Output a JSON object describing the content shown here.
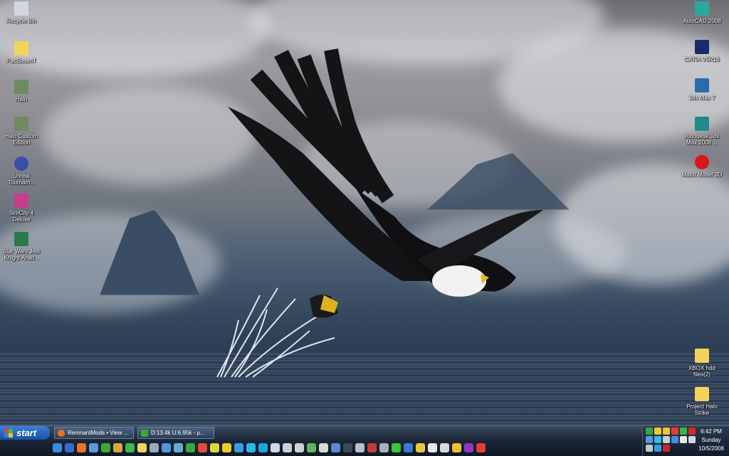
{
  "desktop": {
    "left_icons": [
      {
        "label": "Recycle Bin",
        "icon": "recycle-bin-icon",
        "color": "#cfd8e0"
      },
      {
        "label": "PacSteamT",
        "icon": "folder-icon",
        "color": "#f3d35a"
      },
      {
        "label": "Halo",
        "icon": "halo-icon",
        "color": "#6e8a5e"
      },
      {
        "label": "Halo Custom Edition",
        "icon": "halo-ce-icon",
        "color": "#6e8a5e"
      },
      {
        "label": "Unreal Tournam...",
        "icon": "unreal-icon",
        "color": "#3a4ea8"
      },
      {
        "label": "SimCity 4 Deluxe",
        "icon": "simcity-icon",
        "color": "#c83c8c"
      },
      {
        "label": "Star Wars Jedi Knight Acad...",
        "icon": "jedi-knight-icon",
        "color": "#2a7a4a"
      }
    ],
    "right_icons": [
      {
        "label": "AutoCAD 2008",
        "icon": "autocad-icon",
        "color": "#2aa8a0"
      },
      {
        "label": "CATIA V5R16",
        "icon": "catia-icon",
        "color": "#1a2a6a"
      },
      {
        "label": "3ds Max 7",
        "icon": "3dsmax-icon",
        "color": "#2a6aaa"
      },
      {
        "label": "Autodesk 3ds Max 2008 ...",
        "icon": "3dsmax-2008-icon",
        "color": "#1f8a8a"
      },
      {
        "label": "Matrit Model 3D",
        "icon": "model-3d-icon",
        "color": "#d81818"
      },
      {
        "label": "XBOX hdd files(2)",
        "icon": "folder-icon",
        "color": "#f3d35a"
      },
      {
        "label": "Project Halo Strike",
        "icon": "folder-icon",
        "color": "#f3d35a"
      }
    ]
  },
  "taskbar": {
    "start_label": "start",
    "tasks": [
      {
        "label": "RemnantMods • View ...",
        "icon": "firefox-icon",
        "color": "#e8742a"
      },
      {
        "label": "D:13.4k U:6.95k - µ...",
        "icon": "utorrent-icon",
        "color": "#3aa83a"
      }
    ],
    "quicklaunch": [
      {
        "icon": "ie-icon",
        "color": "#3a8ae0"
      },
      {
        "icon": "outlook-icon",
        "color": "#3a6ad0"
      },
      {
        "icon": "firefox-icon",
        "color": "#e8742a"
      },
      {
        "icon": "desktop-icon",
        "color": "#5a9ad8"
      },
      {
        "icon": "green-app-icon",
        "color": "#3aa83a"
      },
      {
        "icon": "map-icon",
        "color": "#d8a83a"
      },
      {
        "icon": "palm-icon",
        "color": "#3ab84a"
      },
      {
        "icon": "folder-icon",
        "color": "#f3d35a"
      },
      {
        "icon": "gear-icon",
        "color": "#9aa8b8"
      },
      {
        "icon": "globe-icon",
        "color": "#4a9ae0"
      },
      {
        "icon": "image-icon",
        "color": "#6aa8d8"
      },
      {
        "icon": "utorrent-icon",
        "color": "#3aa83a"
      },
      {
        "icon": "media-icon",
        "color": "#e84a3a"
      },
      {
        "icon": "paint-icon",
        "color": "#d8d83a"
      },
      {
        "icon": "smiley-icon",
        "color": "#f0c828"
      },
      {
        "icon": "people-icon",
        "color": "#3a9ae0"
      },
      {
        "icon": "msn-icon",
        "color": "#2ab8e8"
      },
      {
        "icon": "skype-icon",
        "color": "#1aa8e0"
      },
      {
        "icon": "chat-icon",
        "color": "#d0d8e8"
      },
      {
        "icon": "window-icon",
        "color": "#c8d0dc"
      },
      {
        "icon": "cd-icon",
        "color": "#d0d0d0"
      },
      {
        "icon": "tool-icon",
        "color": "#5ab85a"
      },
      {
        "icon": "v-icon",
        "color": "#d8d8d8"
      },
      {
        "icon": "ie2-icon",
        "color": "#5a8ad0"
      },
      {
        "icon": "steam-icon",
        "color": "#3a4a5a"
      },
      {
        "icon": "speaker-icon",
        "color": "#b8c0c8"
      },
      {
        "icon": "red-app-icon",
        "color": "#c83a3a"
      },
      {
        "icon": "gamepad-icon",
        "color": "#a8b0b8"
      },
      {
        "icon": "bar-icon",
        "color": "#3ac83a"
      },
      {
        "icon": "blue-ball-icon",
        "color": "#3a78d8"
      },
      {
        "icon": "yellow-icon",
        "color": "#e8c83a"
      },
      {
        "icon": "white-ball-icon",
        "color": "#e8e8e8"
      },
      {
        "icon": "target-icon",
        "color": "#d8d8e0"
      },
      {
        "icon": "star-icon",
        "color": "#f0c028"
      },
      {
        "icon": "purple-icon",
        "color": "#8a3ac8"
      },
      {
        "icon": "red-dot-icon",
        "color": "#e83a3a"
      }
    ],
    "tray_icons": [
      {
        "icon": "utorrent-tray-icon",
        "color": "#3aa83a"
      },
      {
        "icon": "smiley-tray-icon",
        "color": "#f0c828"
      },
      {
        "icon": "aim-tray-icon",
        "color": "#e8c828"
      },
      {
        "icon": "red-tray-icon",
        "color": "#e83a3a"
      },
      {
        "icon": "green-tray-icon",
        "color": "#3ab84a"
      },
      {
        "icon": "antivirus-tray-icon",
        "color": "#d82828"
      },
      {
        "icon": "network-tray-icon",
        "color": "#5a9ad8"
      },
      {
        "icon": "msn-tray-icon",
        "color": "#3ab8e8"
      },
      {
        "icon": "speaker-tray-icon",
        "color": "#c8d0d8"
      },
      {
        "icon": "display-tray-icon",
        "color": "#4a8ae0"
      },
      {
        "icon": "shield-tray-icon",
        "color": "#e8e8e8"
      },
      {
        "icon": "chat-tray-icon",
        "color": "#d0d8e8"
      },
      {
        "icon": "volume-tray-icon",
        "color": "#c0c8d0"
      },
      {
        "icon": "people-tray-icon",
        "color": "#3a9ae0"
      },
      {
        "icon": "red-circle-tray-icon",
        "color": "#c82828"
      }
    ],
    "clock": {
      "time": "6:42 PM",
      "day": "Sunday",
      "date": "10/5/2008"
    }
  }
}
